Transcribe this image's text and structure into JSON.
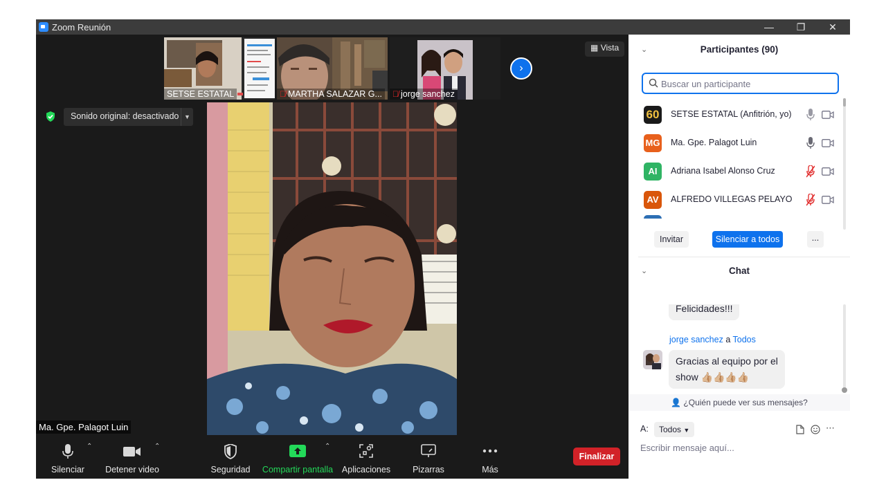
{
  "window": {
    "title": "Zoom Reunión",
    "minimize": "—",
    "restore": "❐",
    "close": "✕"
  },
  "strip": {
    "thumbnails": [
      {
        "label": "SETSE ESTATAL",
        "muted": false
      },
      {
        "label": "MARTHA SALAZAR G...",
        "muted": true
      },
      {
        "label": "jorge sanchez",
        "muted": true
      }
    ],
    "view_label": "Vista"
  },
  "main": {
    "sound_label": "Sonido original: desactivado",
    "speaker_name": "Ma. Gpe. Palagot Luin"
  },
  "toolbar": {
    "mute_label": "Silenciar",
    "video_label": "Detener video",
    "security_label": "Seguridad",
    "share_label": "Compartir pantalla",
    "apps_label": "Aplicaciones",
    "whiteboard_label": "Pizarras",
    "more_label": "Más",
    "end_label": "Finalizar"
  },
  "participants": {
    "header": "Participantes (90)",
    "search_placeholder": "Buscar un participante",
    "list": [
      {
        "name": "SETSE ESTATAL (Anfitrión, yo)",
        "initials": "60",
        "color": "#1a1a1a",
        "muted": false
      },
      {
        "name": "Ma. Gpe. Palagot Luin",
        "initials": "MG",
        "color": "#e8601c",
        "muted": false
      },
      {
        "name": "Adriana Isabel Alonso Cruz",
        "initials": "AI",
        "color": "#2fb464",
        "muted": true
      },
      {
        "name": "ALFREDO VILLEGAS PELAYO",
        "initials": "AV",
        "color": "#d9560a",
        "muted": true
      }
    ],
    "invite_label": "Invitar",
    "mute_all_label": "Silenciar a todos",
    "more_label": "..."
  },
  "chat": {
    "header": "Chat",
    "messages": [
      {
        "text": "Felicidades!!!"
      },
      {
        "sender": "jorge sanchez",
        "connector": "a",
        "recipient": "Todos",
        "text_line1": "Gracias al equipo por el",
        "text_line2": "show 👍🏼👍🏼👍🏼👍🏼"
      }
    ],
    "who_can_see": "¿Quién puede ver sus mensajes?",
    "to_label": "A:",
    "to_value": "Todos",
    "input_placeholder": "Escribir mensaje aquí..."
  }
}
